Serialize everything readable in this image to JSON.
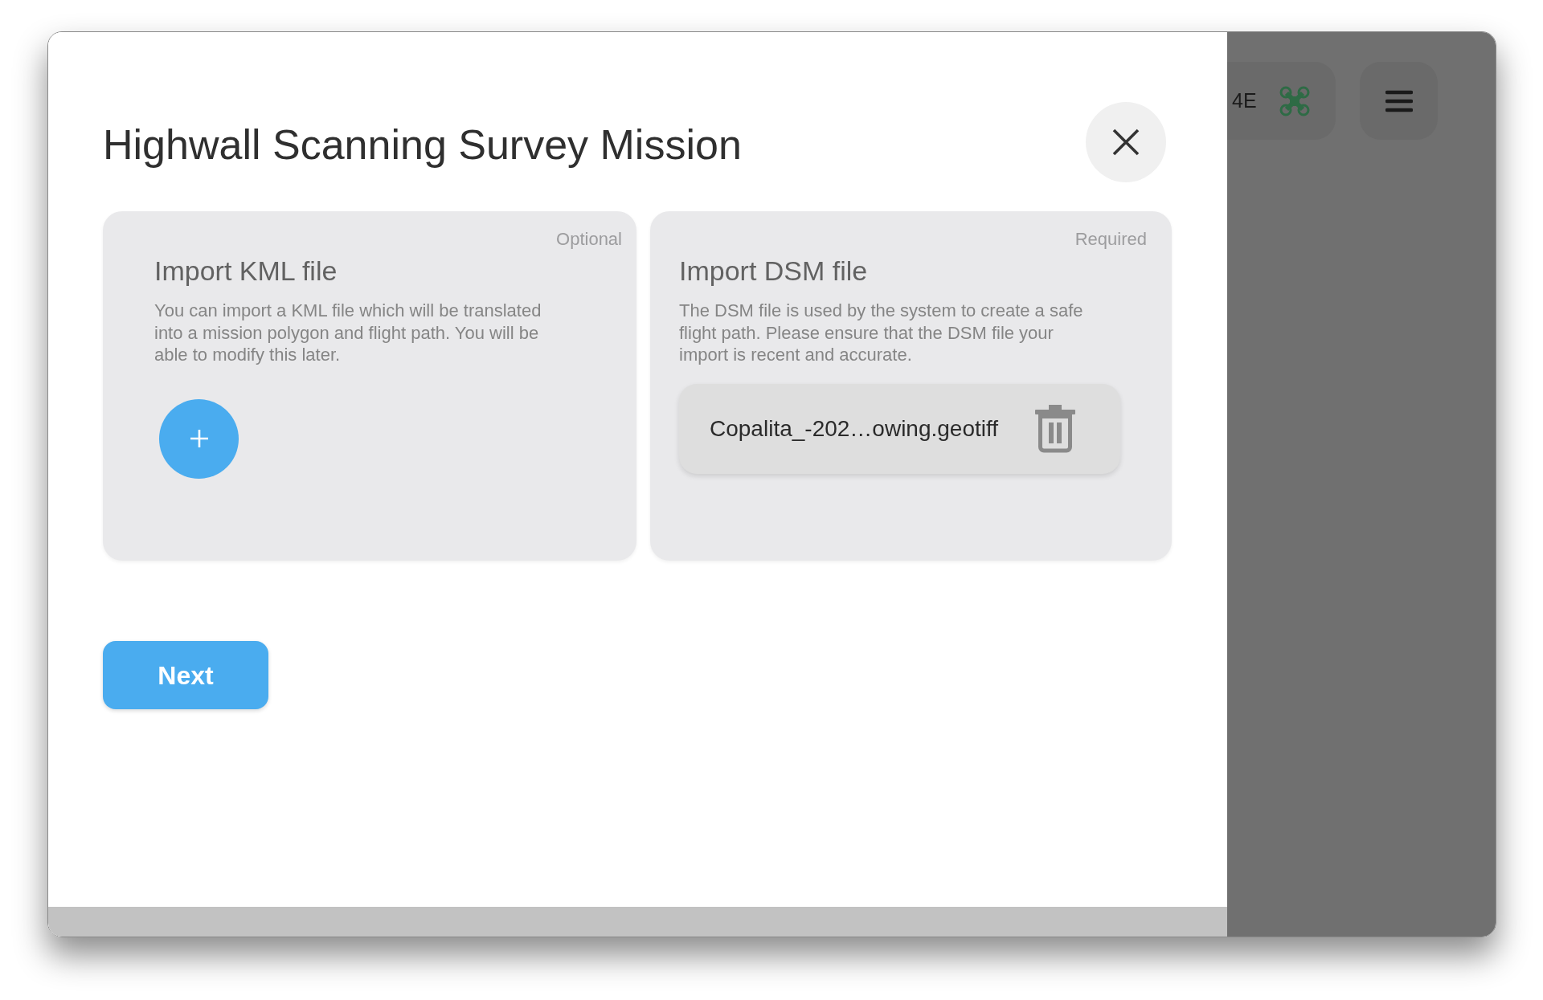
{
  "dialog": {
    "title": "Highwall Scanning Survey Mission",
    "cards": [
      {
        "kind": "upload",
        "badge": "Optional",
        "title": "Import KML file",
        "description": "You can import a KML file which will be translated into a mission polygon and flight path. You will be able to modify this later."
      },
      {
        "kind": "file",
        "badge": "Required",
        "title": "Import DSM file",
        "description": "The DSM file is used by the system to create a safe flight path. Please ensure that the DSM file your import is recent and accurate.",
        "file_name": "Copalita_-202…owing.geotiff"
      }
    ],
    "next_button": "Next"
  },
  "background": {
    "device_chip": "4E"
  }
}
